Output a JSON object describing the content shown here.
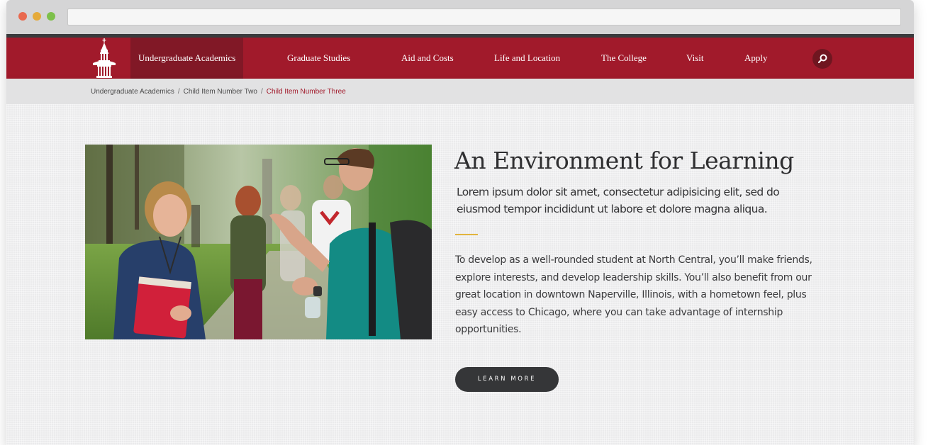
{
  "browser": {
    "window_controls": [
      "close",
      "minimize",
      "maximize"
    ],
    "address_value": ""
  },
  "nav": {
    "logo_icon": "bell-tower-logo-icon",
    "items": [
      {
        "label": "Undergraduate Academics",
        "active": true
      },
      {
        "label": "Graduate Studies",
        "active": false
      },
      {
        "label": "Aid and Costs",
        "active": false
      },
      {
        "label": "Life and Location",
        "active": false
      },
      {
        "label": "The College",
        "active": false
      },
      {
        "label": "Visit",
        "active": false
      },
      {
        "label": "Apply",
        "active": false
      }
    ],
    "search_icon": "search-icon"
  },
  "breadcrumb": {
    "items": [
      "Undergraduate Academics",
      "Child Item Number Two",
      "Child Item Number Three"
    ],
    "separator": "/"
  },
  "feature": {
    "image": "photo-students-talking-outdoors",
    "title": "An Environment for Learning",
    "lead": "Lorem ipsum dolor sit amet, consectetur adipisicing elit, sed do eiusmod tempor incididunt ut labore et dolore magna aliqua.",
    "body": "To develop as a well-rounded student at North Central, you’ll make friends, explore interests, and develop leadership skills. You’ll also benefit from our great location in downtown Naperville, Illinois, with a hometown feel, plus easy access to Chicago, where you can take advantage of internship opportunities.",
    "button_label": "LEARN MORE"
  },
  "colors": {
    "brand_red": "#a11a2b",
    "brand_red_active": "#811826",
    "accent_gold": "#e2b53e",
    "button_dark": "#353638",
    "page_background": "#ebebec"
  }
}
